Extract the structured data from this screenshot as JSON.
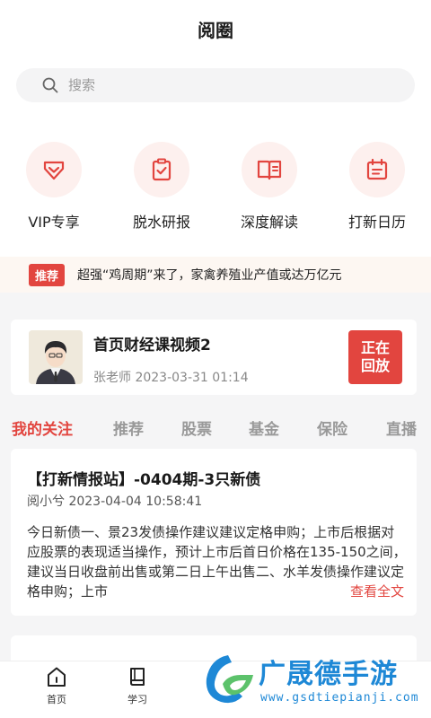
{
  "header": {
    "title": "阅圈"
  },
  "search": {
    "placeholder": "搜索"
  },
  "quick_links": [
    {
      "label": "VIP专享",
      "icon": "vip-shield-icon"
    },
    {
      "label": "脱水研报",
      "icon": "clipboard-check-icon"
    },
    {
      "label": "深度解读",
      "icon": "book-open-icon"
    },
    {
      "label": "打新日历",
      "icon": "calendar-icon"
    }
  ],
  "news": {
    "badge": "推荐",
    "text": "超强“鸡周期”来了，家禽养殖业产值或达万亿元"
  },
  "live": {
    "title": "首页财经课视频2",
    "meta": "张老师 2023-03-31 01:14",
    "replay_line1": "正在",
    "replay_line2": "回放"
  },
  "tabs": [
    "我的关注",
    "推荐",
    "股票",
    "基金",
    "保险",
    "直播"
  ],
  "active_tab": "我的关注",
  "article": {
    "title": "【打新情报站】-0404期-3只新债",
    "meta": "阅小兮 2023-04-04 10:58:41",
    "body": "今日新债一、景23发债操作建议建议定格申购；上市后根据对应股票的表现适当操作，预计上市后首日价格在135-150之间，建议当日收盘前出售或第二日上午出售二、水羊发债操作建议定格申购；上市",
    "more": "查看全文"
  },
  "bottom_nav": [
    {
      "label": "首页",
      "icon": "home-icon"
    },
    {
      "label": "学习",
      "icon": "book-icon"
    }
  ],
  "watermark": {
    "name": "广晟德手游",
    "url": "www.gsdtiepianji.com"
  },
  "colors": {
    "accent": "#e2453f",
    "icon_bg": "#fdf0ee",
    "watermark": "#1e88d6"
  }
}
